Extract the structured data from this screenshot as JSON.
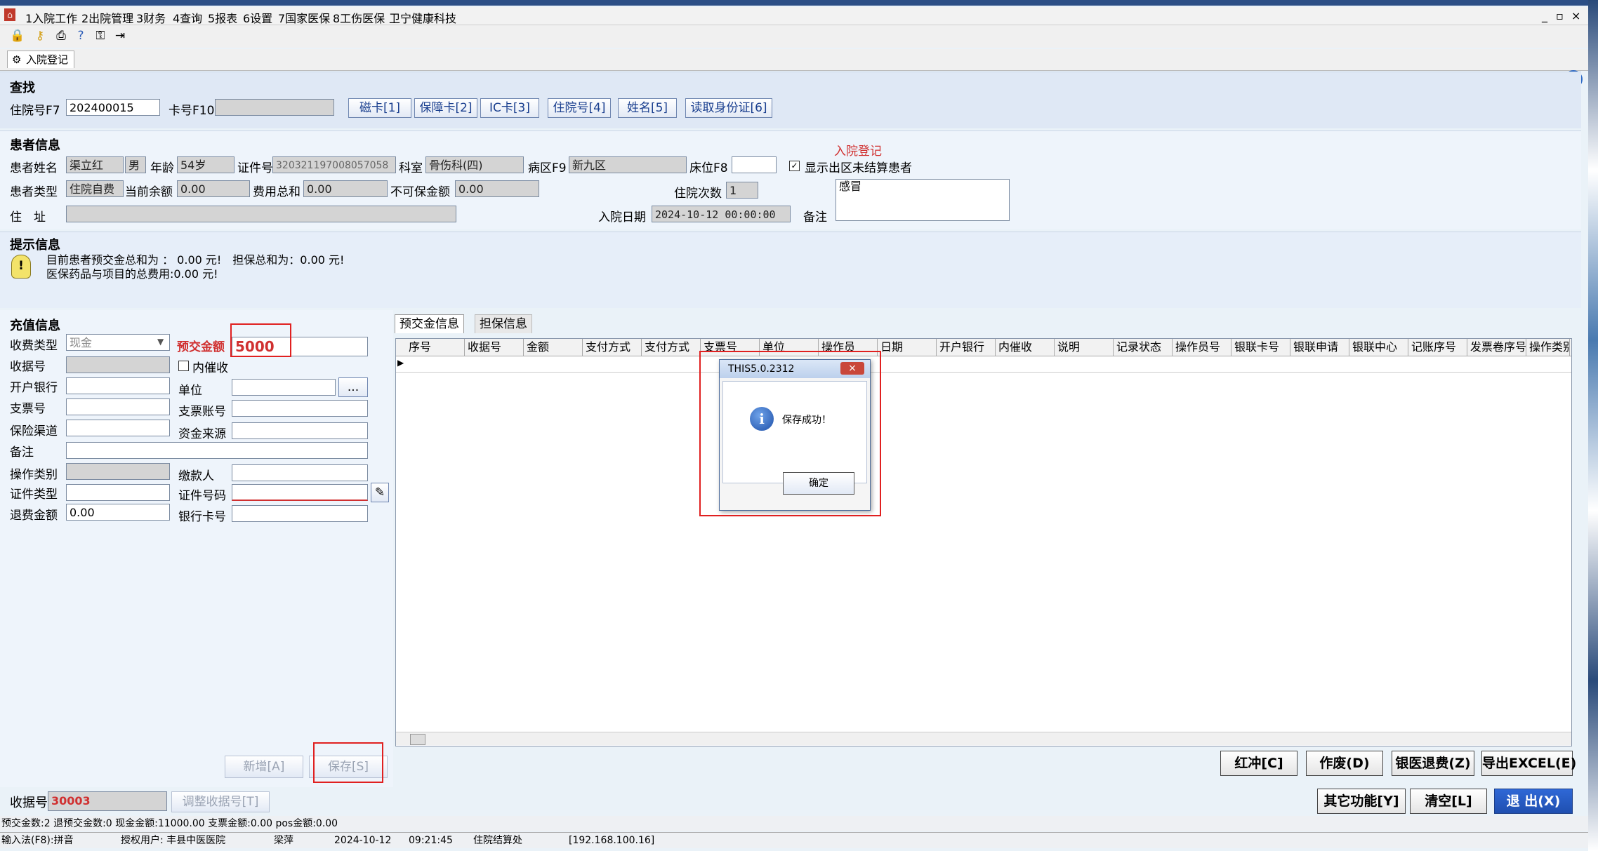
{
  "menu": [
    "1入院工作",
    "2出院管理",
    "3财务",
    "4查询",
    "5报表",
    "6设置",
    "7国家医保",
    "8工伤医保",
    "卫宁健康科技"
  ],
  "window_controls": [
    "_",
    "▫",
    "×"
  ],
  "toolbar_icons": [
    "lock-icon",
    "key-icon",
    "print-icon",
    "help-icon",
    "user-lock-icon",
    "exit-icon"
  ],
  "active_tab": "入院登记",
  "search": {
    "title": "查找",
    "inpatient_no_label": "住院号F7",
    "inpatient_no_value": "202400015",
    "card_no_label": "卡号F10",
    "card_no_value": "",
    "buttons": [
      "磁卡[1]",
      "保障卡[2]",
      "IC卡[3]",
      "住院号[4]",
      "姓名[5]",
      "读取身份证[6]"
    ]
  },
  "patient": {
    "title": "患者信息",
    "admission_note": "入院登记",
    "name_label": "患者姓名",
    "name": "渠立红",
    "sex": "男",
    "age_label": "年龄",
    "age": "54岁",
    "id_label": "证件号",
    "id_no": "320321197008057058",
    "dept_label": "科室",
    "dept": "骨伤科(四)",
    "ward_label": "病区F9",
    "ward": "新九区",
    "bed_label": "床位F8",
    "bed": "",
    "show_unsettled_label": "显示出区未结算患者",
    "show_unsettled": "✓",
    "type_label": "患者类型",
    "type": "住院自费",
    "balance_label": "当前余额",
    "balance": "0.00",
    "fee_total_label": "费用总和",
    "fee_total": "0.00",
    "noguarantee_label": "不可保金额",
    "noguarantee": "0.00",
    "visits_label": "住院次数",
    "visits": "1",
    "address_label": "住　址",
    "address": "",
    "admit_date_label": "入院日期",
    "admit_date": "2024-10-12 00:00:00",
    "remark_label": "备注",
    "remark": "感冒"
  },
  "hint": {
    "title": "提示信息",
    "line1": "目前患者预交金总和为 ： 0.00 元!　担保总和为：0.00 元!",
    "line2": "医保药品与项目的总费用:0.00 元!"
  },
  "recharge": {
    "title": "充值信息",
    "pay_type_label": "收费类型",
    "pay_type": "现金",
    "prepay_label": "预交金额",
    "prepay": "5000",
    "receipt_label": "收据号",
    "receipt": "",
    "internal_label": "内催收",
    "bank_label": "开户银行",
    "bank": "",
    "unit_label": "单位",
    "unit": "",
    "unit_btn": "...",
    "cheque_label": "支票号",
    "cheque": "",
    "cheque_acct_label": "支票账号",
    "cheque_acct": "",
    "insurance_label": "保险渠道",
    "insurance": "",
    "fund_label": "资金来源",
    "fund": "",
    "remark_label": "备注",
    "remark": "",
    "op_type_label": "操作类别",
    "op_type": "",
    "payer_label": "缴款人",
    "payer": "",
    "cert_type_label": "证件类型",
    "cert_type": "",
    "cert_no_label": "证件号码",
    "cert_no": "",
    "refund_label": "退费金额",
    "refund": "0.00",
    "bank_card_label": "银行卡号",
    "bank_card": "",
    "new_btn": "新增[A]",
    "save_btn": "保存[S]"
  },
  "grid": {
    "tabs": [
      "预交金信息",
      "担保信息"
    ],
    "columns": [
      "序号",
      "收据号",
      "金额",
      "支付方式",
      "支付方式",
      "支票号",
      "单位",
      "操作员",
      "日期",
      "开户银行",
      "内催收",
      "说明",
      "记录状态",
      "操作员号",
      "银联卡号",
      "银联申请",
      "银联中心",
      "记账序号",
      "发票卷序号",
      "操作类别"
    ]
  },
  "actions": {
    "red_btn": "红冲[C]",
    "void_btn": "作废(D)",
    "refund_btn": "银医退费(Z)",
    "export_btn": "导出EXCEL(E)",
    "other_btn": "其它功能[Y]",
    "clear_btn": "清空[L]",
    "exit_btn": "退 出(X)"
  },
  "receipt_bottom": {
    "label": "收据号",
    "value": "30003",
    "adjust_btn": "调整收据号[T]"
  },
  "status": {
    "line1": "预交金数:2 退预交金数:0 现金金额:11000.00 支票金额:0.00 pos金额:0.00",
    "input_method": "输入法(F8):拼音",
    "auth_user": "授权用户: 丰县中医医院",
    "operator": "梁萍",
    "date": "2024-10-12",
    "time": "09:21:45",
    "station": "住院结算处",
    "ip": "[192.168.100.16]"
  },
  "dialog": {
    "title": "THIS5.0.2312",
    "close": "×",
    "message": "保存成功！",
    "ok": "确定",
    "icon": "info-icon"
  }
}
